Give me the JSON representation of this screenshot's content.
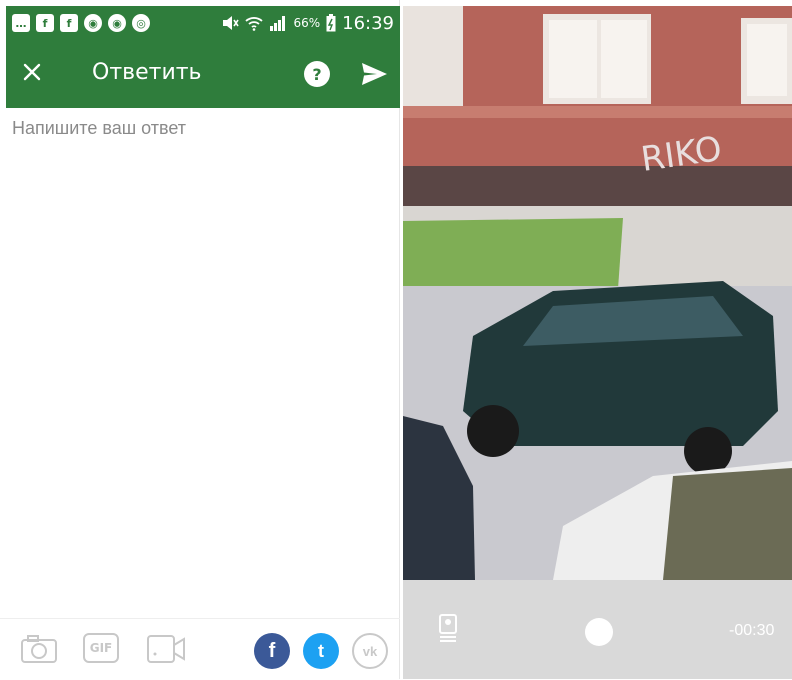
{
  "status_bar": {
    "battery": "66%",
    "time": "16:39",
    "icons": [
      "chat-icon",
      "facebook-icon",
      "facebook-icon",
      "owl-icon",
      "owl-icon",
      "chrome-icon",
      "mute-icon",
      "wifi-icon",
      "signal-icon",
      "battery-icon"
    ]
  },
  "app_bar": {
    "title": "Ответить",
    "help_label": "?"
  },
  "answer": {
    "placeholder": "Напишите ваш ответ"
  },
  "toolbar": {
    "gif_label": "GIF",
    "facebook_label": "f",
    "twitter_label": "t",
    "vk_label": "vk"
  },
  "camera": {
    "timer": "-00:30",
    "graffiti": "RIKO"
  },
  "colors": {
    "brand_green": "#2f7d3c",
    "facebook": "#3b5998",
    "twitter": "#1da1f2",
    "vk_outline": "#c9c9c9"
  }
}
